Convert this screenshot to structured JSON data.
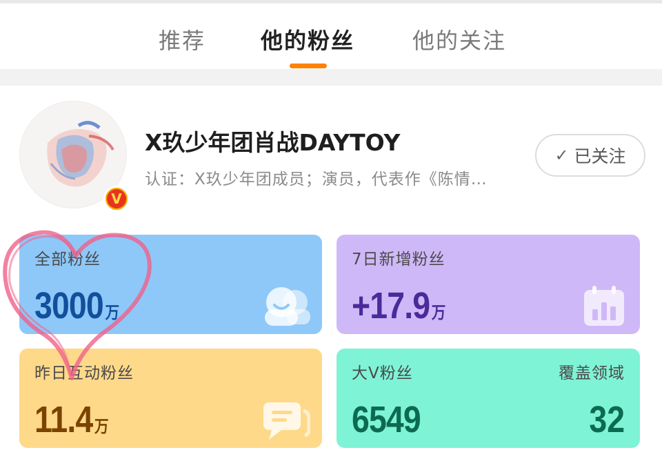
{
  "tabs": [
    {
      "label": "推荐"
    },
    {
      "label": "他的粉丝"
    },
    {
      "label": "他的关注"
    }
  ],
  "active_tab": "他的粉丝",
  "accent_color": "#ff8200",
  "profile": {
    "avatar_icon": "artwork-avatar",
    "badge_icon": "verified-v-icon",
    "badge_text": "V",
    "name": "X玖少年团肖战DAYTOY",
    "verification": "认证：X玖少年团成员；演员，代表作《陈情…",
    "follow_button_label": "已关注",
    "follow_icon": "check-icon"
  },
  "stats": {
    "all_fans": {
      "label": "全部粉丝",
      "value": "3000",
      "unit": "万",
      "icon": "fans-faces-icon",
      "color": "#8ec8f9"
    },
    "new_7day": {
      "label": "7日新增粉丝",
      "value": "+17.9",
      "unit": "万",
      "icon": "calendar-chart-icon",
      "color": "#cfb8f8"
    },
    "yesterday_interactive": {
      "label": "昨日互动粉丝",
      "value": "11.4",
      "unit": "万",
      "icon": "chat-bubble-icon",
      "color": "#fed98a"
    },
    "big_v": {
      "label": "大V粉丝",
      "value": "6549",
      "coverage_label": "覆盖领域",
      "coverage_value": "32",
      "color": "#7ff3d6"
    }
  },
  "annotation": {
    "shape": "hand-drawn-heart",
    "color": "#f0628a"
  }
}
